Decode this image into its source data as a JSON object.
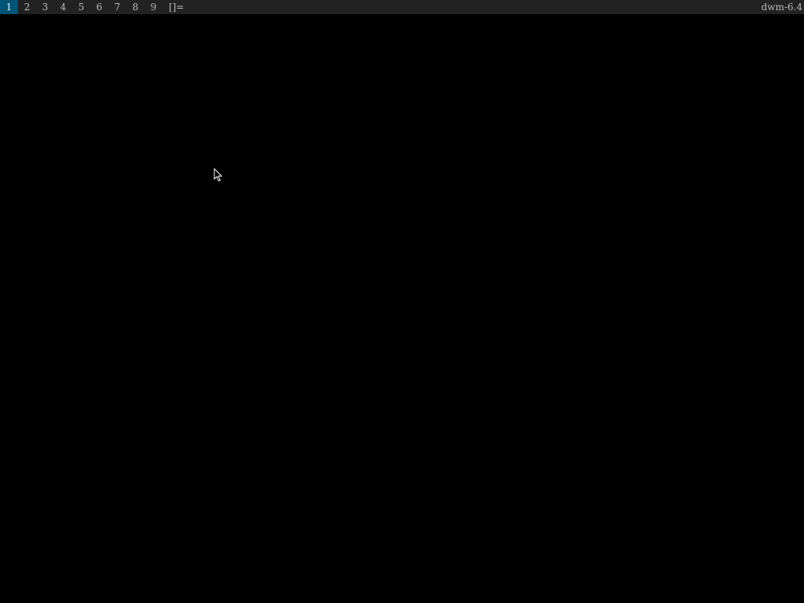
{
  "bar": {
    "tags": [
      {
        "label": "1",
        "selected": true
      },
      {
        "label": "2",
        "selected": false
      },
      {
        "label": "3",
        "selected": false
      },
      {
        "label": "4",
        "selected": false
      },
      {
        "label": "5",
        "selected": false
      },
      {
        "label": "6",
        "selected": false
      },
      {
        "label": "7",
        "selected": false
      },
      {
        "label": "8",
        "selected": false
      },
      {
        "label": "9",
        "selected": false
      }
    ],
    "layout_symbol": "[]=",
    "status_text": "dwm-6.4"
  },
  "colors": {
    "bar_background": "#222222",
    "bar_text": "#bbbbbb",
    "selected_background": "#005577",
    "selected_text": "#eeeeee",
    "desktop_background": "#000000"
  },
  "cursor": {
    "icon": "arrow-pointer-icon"
  }
}
